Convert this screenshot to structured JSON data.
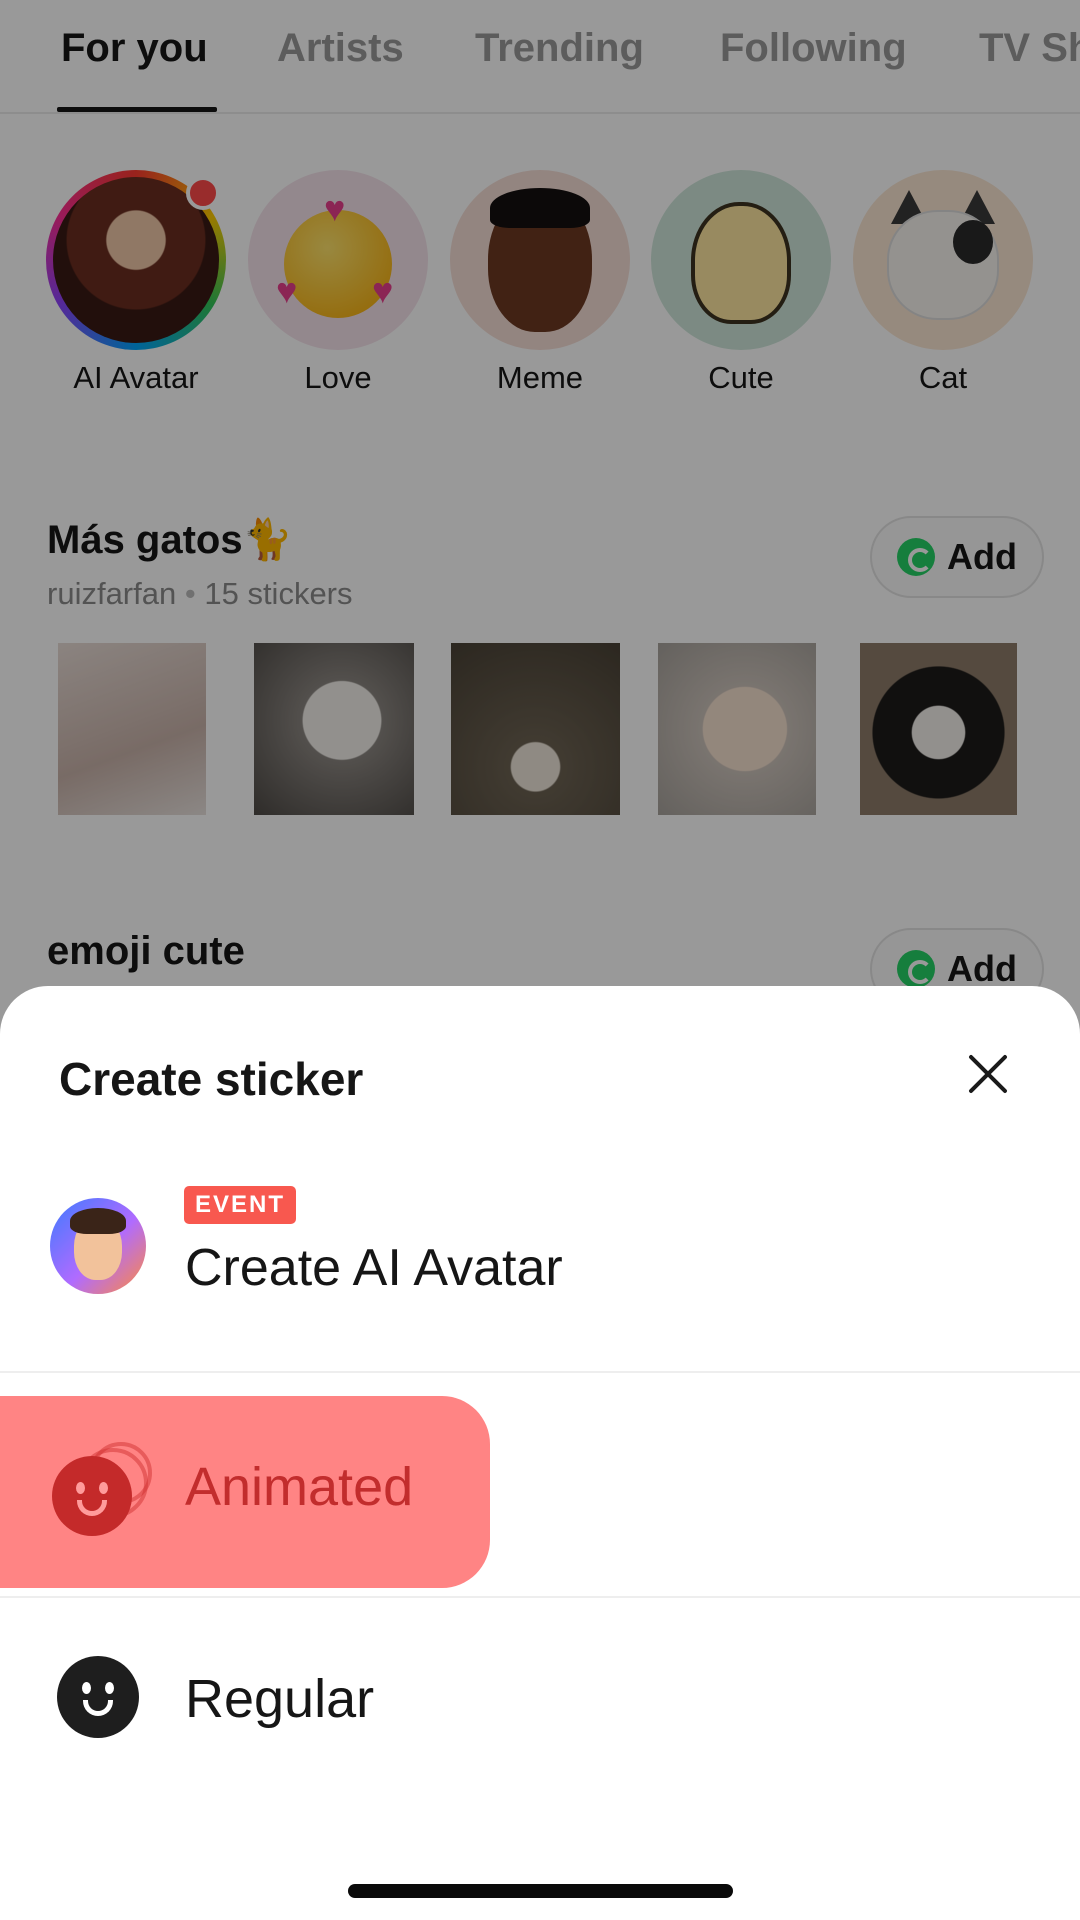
{
  "tabs": [
    {
      "label": "For you",
      "active": true
    },
    {
      "label": "Artists",
      "active": false
    },
    {
      "label": "Trending",
      "active": false
    },
    {
      "label": "Following",
      "active": false
    },
    {
      "label": "TV Sh",
      "active": false
    }
  ],
  "categories": [
    {
      "label": "AI Avatar",
      "icon": "ai-avatar-girl",
      "has_new_dot": true
    },
    {
      "label": "Love",
      "icon": "love-emoji"
    },
    {
      "label": "Meme",
      "icon": "meme-face"
    },
    {
      "label": "Cute",
      "icon": "cute-duck"
    },
    {
      "label": "Cat",
      "icon": "cat-face"
    }
  ],
  "packs": [
    {
      "title": "Más gatos🐈",
      "author": "ruizfarfan",
      "separator": "•",
      "count": "15 stickers",
      "add_label": "Add"
    },
    {
      "title": "emoji cute",
      "add_label": "Add"
    }
  ],
  "sheet": {
    "title": "Create sticker",
    "options": {
      "ai_avatar": {
        "badge": "EVENT",
        "label": "Create AI Avatar"
      },
      "animated": {
        "label": "Animated",
        "selected": true
      },
      "regular": {
        "label": "Regular"
      }
    }
  },
  "colors": {
    "badge": "#f8584f",
    "animated_highlight": "#ff8484",
    "animated_text": "#c22d2d",
    "whatsapp": "#25d366"
  }
}
